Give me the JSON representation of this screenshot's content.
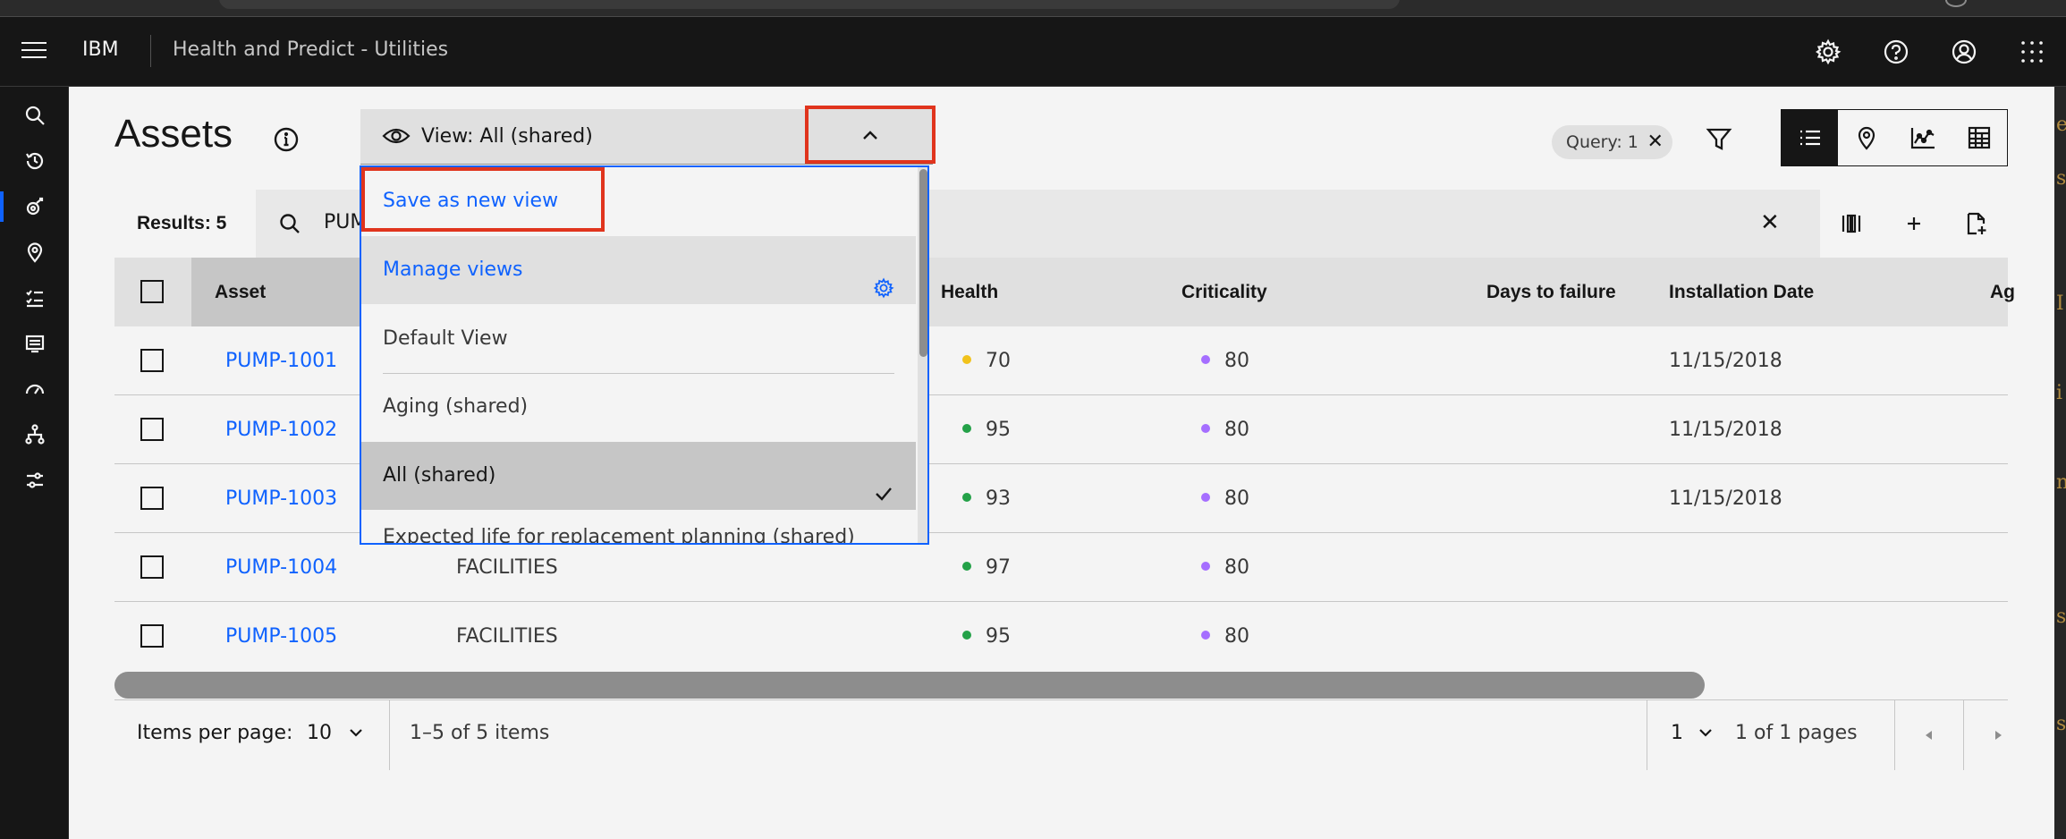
{
  "header": {
    "brand": "IBM",
    "product": "Health and Predict - Utilities",
    "actions": [
      "settings-icon",
      "help-icon",
      "user-icon",
      "app-switcher-icon"
    ]
  },
  "siderail": {
    "items": [
      "search-icon",
      "recent-icon",
      "assets-icon",
      "location-icon",
      "checklist-icon",
      "dashboard-icon",
      "gauge-icon",
      "hierarchy-icon",
      "sliders-icon"
    ],
    "active": "assets-icon"
  },
  "page": {
    "title": "Assets",
    "view_select_label": "View: All (shared)",
    "query_tag": "Query: 1",
    "query_tag_close": "✕"
  },
  "dropdown": {
    "save_as_new": "Save as new view",
    "manage_views": "Manage views",
    "items": [
      "Default View",
      "Aging (shared)",
      "All (shared)",
      "Expected life for replacement planning (shared)"
    ],
    "selected": "All (shared)"
  },
  "toolbar": {
    "results": "Results: 5",
    "search_value": "PUM",
    "clear": "✕"
  },
  "table": {
    "columns": {
      "asset": "Asset",
      "health": "Health",
      "criticality": "Criticality",
      "days_to_failure": "Days to failure",
      "installation_date": "Installation Date",
      "age": "Ag"
    },
    "rows": [
      {
        "asset": "PUMP-1001",
        "site": "",
        "health": "70",
        "health_color": "#f1c21b",
        "criticality": "80",
        "install": "11/15/2018"
      },
      {
        "asset": "PUMP-1002",
        "site": "",
        "health": "95",
        "health_color": "#24a148",
        "criticality": "80",
        "install": "11/15/2018"
      },
      {
        "asset": "PUMP-1003",
        "site": "",
        "health": "93",
        "health_color": "#24a148",
        "criticality": "80",
        "install": "11/15/2018"
      },
      {
        "asset": "PUMP-1004",
        "site": "FACILITIES",
        "health": "97",
        "health_color": "#24a148",
        "criticality": "80",
        "install": ""
      },
      {
        "asset": "PUMP-1005",
        "site": "FACILITIES",
        "health": "95",
        "health_color": "#24a148",
        "criticality": "80",
        "install": ""
      }
    ],
    "criticality_color": "#a56eff"
  },
  "pagination": {
    "items_per_page_label": "Items per page:",
    "items_per_page": "10",
    "range": "1–5 of 5 items",
    "page": "1",
    "pages": "1 of 1 pages"
  },
  "right_strip_glyphs": [
    "e",
    "s",
    "I",
    "i",
    "n",
    "s",
    "s"
  ],
  "colors": {
    "accent": "#0f62fe",
    "highlight": "#e0341d",
    "header_bg": "#161616"
  }
}
